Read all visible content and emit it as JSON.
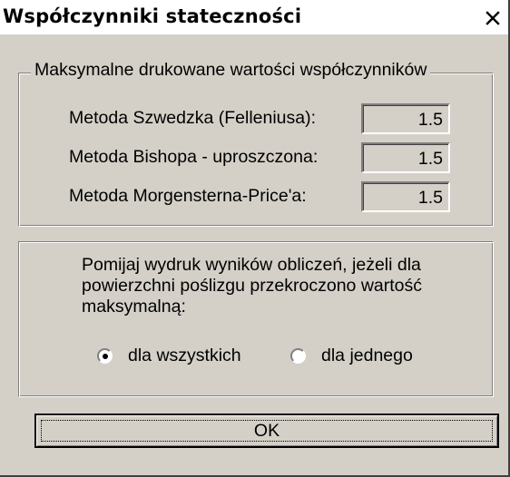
{
  "window": {
    "title": "Współczynniki stateczności",
    "close_icon": "close-icon"
  },
  "max_values": {
    "legend": "Maksymalne drukowane wartości współczynników",
    "rows": [
      {
        "label": "Metoda Szwedzka (Felleniusa):",
        "value": "1.5"
      },
      {
        "label": "Metoda Bishopa - uproszczona:",
        "value": "1.5"
      },
      {
        "label": "Metoda Morgensterna-Price'a:",
        "value": "1.5"
      }
    ]
  },
  "skip_output": {
    "text": "Pomijaj wydruk wyników obliczeń, jeżeli dla powierzchni poślizgu przekroczono wartość maksymalną:",
    "options": [
      {
        "label": "dla wszystkich",
        "selected": true
      },
      {
        "label": "dla jednego",
        "selected": false
      }
    ]
  },
  "buttons": {
    "ok_label": "OK"
  },
  "colors": {
    "face": "#d4d0c8",
    "shadow": "#808080",
    "highlight": "#ffffff"
  }
}
